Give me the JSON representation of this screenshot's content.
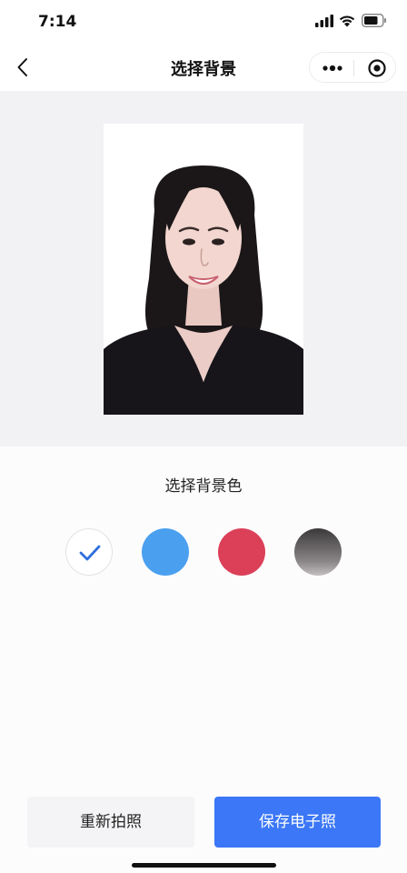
{
  "status_bar": {
    "time": "7:14"
  },
  "nav": {
    "title": "选择背景"
  },
  "photo": {
    "description_icon": "portrait-photo"
  },
  "background_picker": {
    "label": "选择背景色",
    "options": [
      {
        "name": "white",
        "color": "#ffffff",
        "selected": true
      },
      {
        "name": "blue",
        "color": "#4aa0ef",
        "selected": false
      },
      {
        "name": "red",
        "color": "#db4058",
        "selected": false
      },
      {
        "name": "gradient-gray",
        "color": "#6e6a6c",
        "selected": false
      }
    ],
    "check_color": "#2f6fde"
  },
  "actions": {
    "retake_label": "重新拍照",
    "save_label": "保存电子照",
    "save_color": "#3b77f6"
  }
}
